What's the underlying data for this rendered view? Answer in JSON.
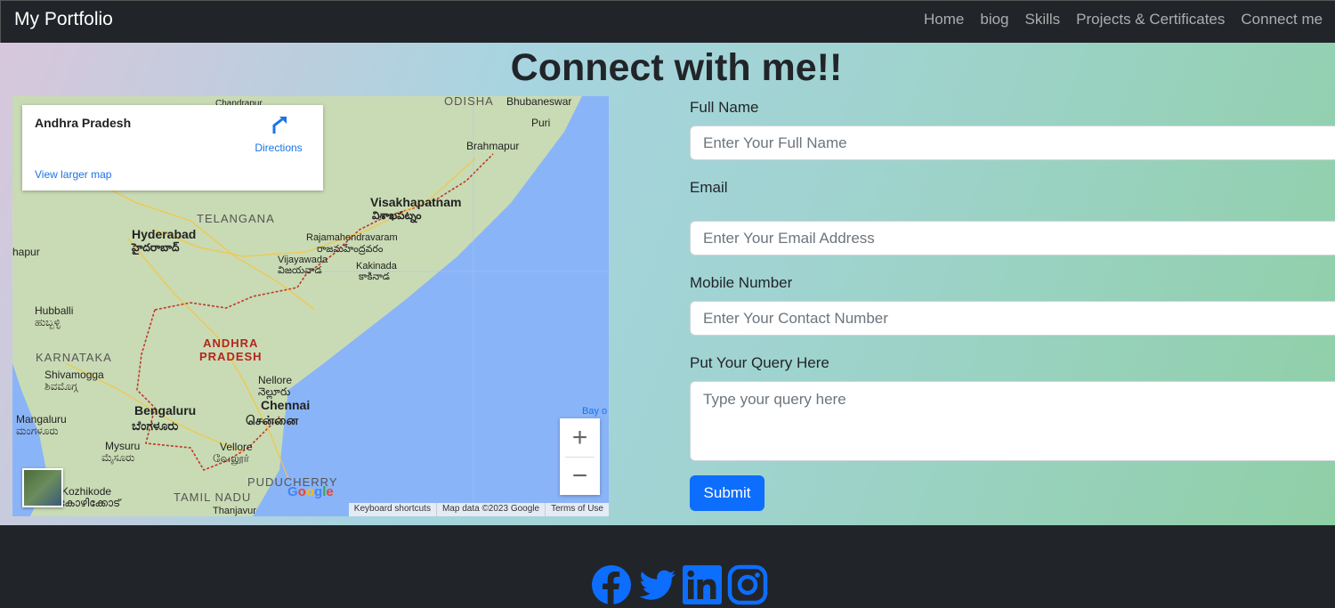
{
  "navbar": {
    "brand": "My Portfolio",
    "links": [
      "Home",
      "biog",
      "Skills",
      "Projects & Certificates",
      "Connect me"
    ]
  },
  "main": {
    "title": "Connect with me!!"
  },
  "map": {
    "place_title": "Andhra Pradesh",
    "directions_label": "Directions",
    "view_larger": "View larger map",
    "labels": {
      "odisha": "ODISHA",
      "bhubaneswar": "Bhubaneswar",
      "puri": "Puri",
      "chandrapur": "Chandrapur",
      "brahmapur": "Brahmapur",
      "visakhapatnam": "Visakhapatnam",
      "visakhapatnam_te": "విశాఖపట్నం",
      "telangana": "TELANGANA",
      "hyderabad": "Hyderabad",
      "hyderabad_te": "హైదరాబాద్",
      "rajamahendravaram": "Rajamahendravaram",
      "rajamahendravaram_te": "రాజమహేంద్రవరం",
      "vijayawada": "Vijayawada",
      "vijayawada_te": "విజయవాడ",
      "kakinada": "Kakinada",
      "kakinada_te": "కాకినాడ",
      "hapur": "hapur",
      "hubballi": "Hubballi",
      "hubballi_kn": "ಹುಬ್ಬಳ್ಳಿ",
      "ap_line1": "ANDHRA",
      "ap_line2": "PRADESH",
      "karnataka": "KARNATAKA",
      "shivamogga": "Shivamogga",
      "shivamogga_kn": "ಶಿವಮೊಗ್ಗ",
      "nellore": "Nellore",
      "nellore_te": "నెల్లూరు",
      "chennai": "Chennai",
      "chennai_ta": "சென்னை",
      "bengaluru": "Bengaluru",
      "bengaluru_kn": "ಬೆಂಗಳೂರು",
      "mangaluru": "Mangaluru",
      "mangaluru_kn": "ಮಂಗಳೂರು",
      "mysuru": "Mysuru",
      "mysuru_kn": "ಮೈಸೂರು",
      "vellore": "Vellore",
      "vellore_ta": "வேலூர்",
      "kozhikode": "Kozhikode",
      "kozhikode_ml": "കോഴിക്കോട്",
      "tamil_nadu": "TAMIL NADU",
      "puducherry": "PUDUCHERRY",
      "thanjavur": "Thanjavur",
      "bay": "Bay o"
    },
    "zoom_in": "+",
    "zoom_out": "−",
    "google": "Google",
    "attribution": [
      "Keyboard shortcuts",
      "Map data ©2023 Google",
      "Terms of Use"
    ],
    "colors": {
      "water": "#8ab4f8",
      "land": "#c9dbb4",
      "border": "#c0392b"
    }
  },
  "form": {
    "full_name": {
      "label": "Full Name",
      "placeholder": "Enter Your Full Name"
    },
    "email": {
      "label": "Email",
      "placeholder": "Enter Your Email Address"
    },
    "mobile": {
      "label": "Mobile Number",
      "placeholder": "Enter Your Contact Number"
    },
    "query": {
      "label": "Put Your Query Here",
      "placeholder": "Type your query here"
    },
    "submit": "Submit"
  },
  "footer": {
    "icons": [
      "facebook-icon",
      "twitter-icon",
      "linkedin-icon",
      "instagram-icon"
    ],
    "icon_color": "#0d6efd"
  }
}
